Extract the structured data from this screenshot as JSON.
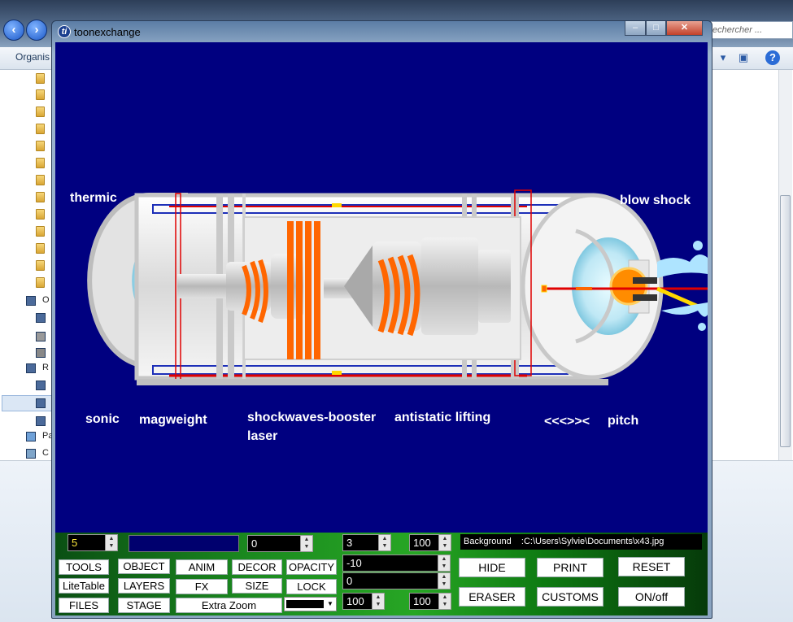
{
  "explorer": {
    "search_placeholder": "echercher ...",
    "organize_label": "Organis",
    "side_labels": [
      "O",
      "R",
      "Pa",
      "C"
    ]
  },
  "window": {
    "title": "toonexchange",
    "icon_letter": "ti",
    "minimize": "–",
    "maximize": "□",
    "close": "✕"
  },
  "stage": {
    "labels": {
      "thermic": "thermic",
      "blow_shock": "blow shock",
      "sonic": "sonic",
      "magweight": "magweight",
      "shockwaves_booster": "shockwaves-booster",
      "laser": "laser",
      "antistatic_lifting": "antistatic lifting",
      "arrows": "<<<>><",
      "pitch": "pitch"
    }
  },
  "panel": {
    "spinners": {
      "layer": "5",
      "value_a": "0",
      "value_b": "3",
      "value_c": "100",
      "offset_x": "-10",
      "offset_y": "0",
      "scale_a": "100",
      "scale_b": "100"
    },
    "background_path": "Background    :C:\\Users\\Sylvie\\Documents\\x43.jpg",
    "buttons": {
      "tools": "TOOLS",
      "object": "OBJECT",
      "anim": "ANIM",
      "decor": "DECOR",
      "opacity": "OPACITY",
      "litetable": "LiteTable",
      "layers": "LAYERS",
      "fx": "FX",
      "size": "SIZE",
      "lock": "LOCK",
      "files": "FILES",
      "stage": "STAGE",
      "extra_zoom": "Extra Zoom",
      "hide": "HIDE",
      "print": "PRINT",
      "reset": "RESET",
      "eraser": "ERASER",
      "customs": "CUSTOMS",
      "onoff": "ON/off"
    },
    "selected_color": "#000000"
  },
  "colors": {
    "stage_bg": "#000080",
    "label": "#ffffff",
    "coil": "#ff6600",
    "laser": "#e00000",
    "panel_green": "#1b8a1f"
  }
}
